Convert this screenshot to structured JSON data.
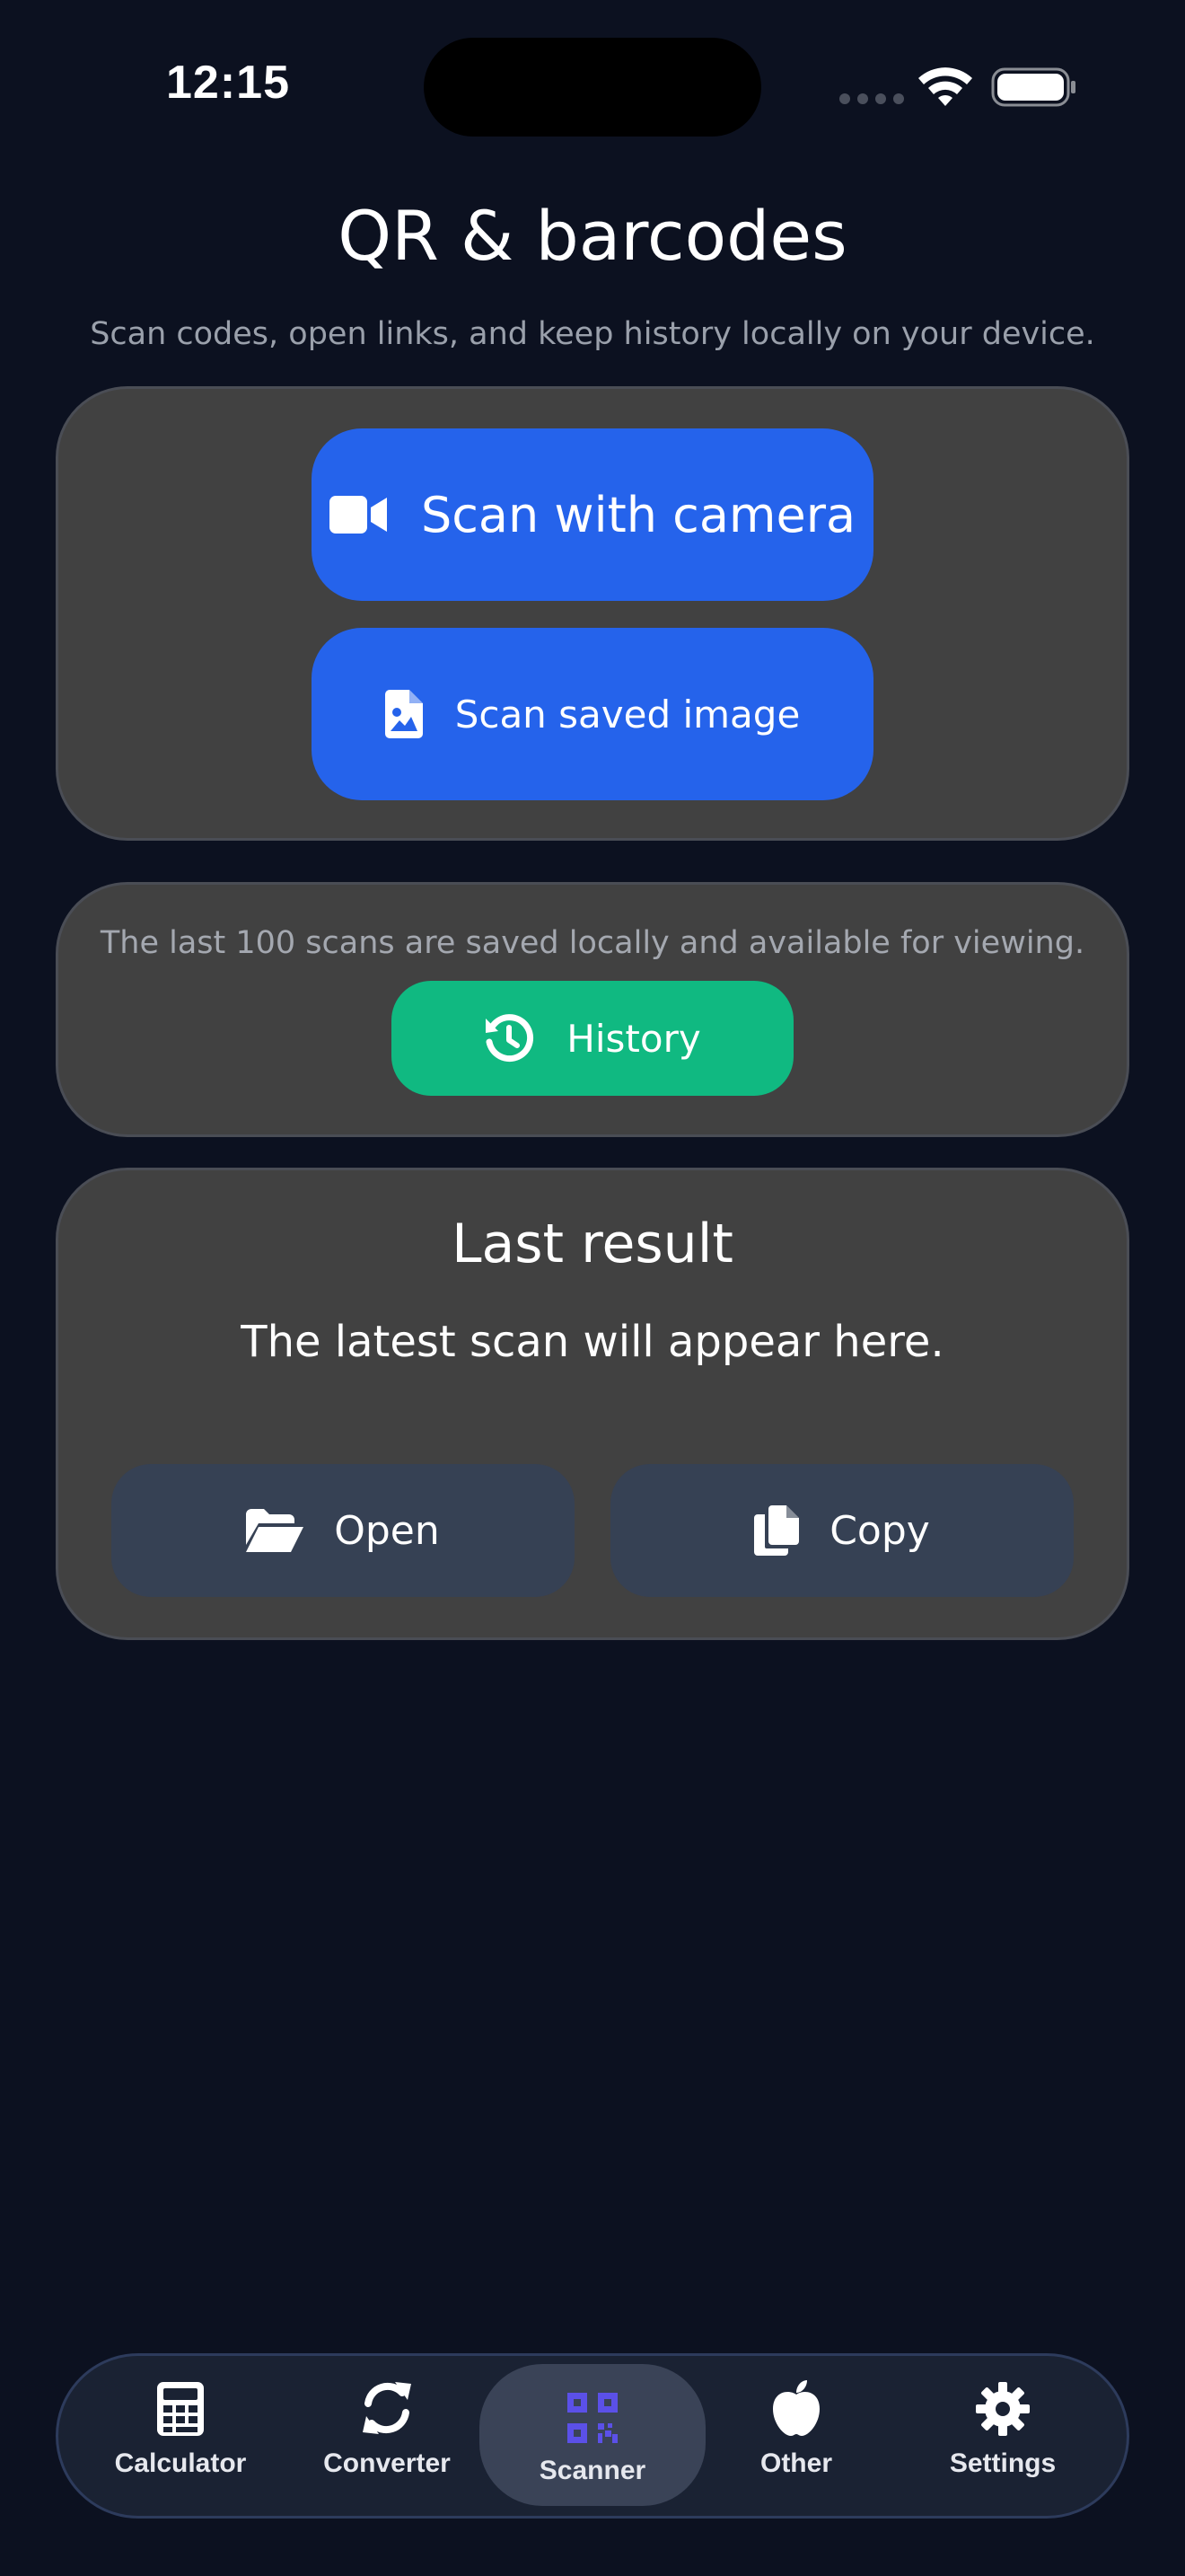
{
  "status_bar": {
    "time": "12:15"
  },
  "header": {
    "title": "QR & barcodes",
    "subtitle": "Scan codes, open links, and keep history locally on your device."
  },
  "scan_card": {
    "camera_button": {
      "label": "Scan with camera",
      "icon": "video-camera-icon"
    },
    "image_button": {
      "label": "Scan saved image",
      "icon": "image-file-icon"
    }
  },
  "history_card": {
    "note": "The last 100 scans are saved locally and available for viewing.",
    "history_button": {
      "label": "History",
      "icon": "history-icon"
    }
  },
  "result_card": {
    "title": "Last result",
    "placeholder": "The latest scan will appear here.",
    "open_button": {
      "label": "Open",
      "icon": "folder-open-icon"
    },
    "copy_button": {
      "label": "Copy",
      "icon": "copy-icon"
    }
  },
  "bottom_nav": {
    "items": [
      {
        "label": "Calculator",
        "icon": "calculator-icon",
        "active": false
      },
      {
        "label": "Converter",
        "icon": "refresh-icon",
        "active": false
      },
      {
        "label": "Scanner",
        "icon": "qr-code-icon",
        "active": true
      },
      {
        "label": "Other",
        "icon": "apple-icon",
        "active": false
      },
      {
        "label": "Settings",
        "icon": "gear-icon",
        "active": false
      }
    ]
  },
  "colors": {
    "background": "#0c1120",
    "card": "#414141",
    "primary_blue": "#2563eb",
    "history_green": "#10b981",
    "secondary_button": "#364154",
    "nav_active_icon": "#5b50e8"
  }
}
